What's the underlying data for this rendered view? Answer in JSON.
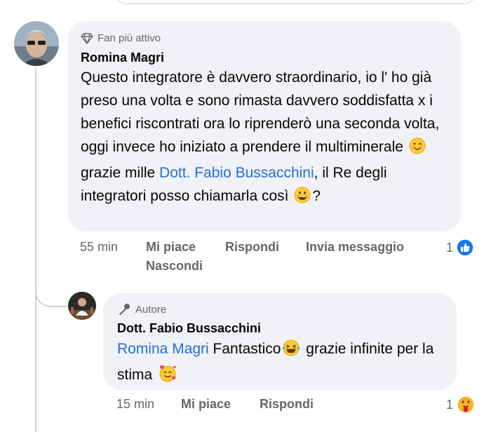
{
  "comment": {
    "badge": "Fan più attivo",
    "author": "Romina Magri",
    "text_part1": "Questo integratore è davvero straordinario, io l' ho già preso una volta e sono rimasta davvero soddisfatta x i benefici riscontrati ora lo riprenderò una seconda volta, oggi invece ho iniziato a prendere il multiminerale ",
    "text_part2": " grazie mille ",
    "mention": "Dott. Fabio Bussacchini",
    "text_part3": ", il Re degli integratori posso chiamarla così ",
    "text_part4": "?",
    "emoji1": "smiling-face-emoji",
    "emoji2": "grinning-face-emoji",
    "time": "55 min",
    "like": "Mi piace",
    "reply": "Rispondi",
    "message": "Invia messaggio",
    "hide": "Nascondi",
    "reaction_count": "1",
    "reaction_icon": "like-icon"
  },
  "reply": {
    "badge": "Autore",
    "author": "Dott. Fabio Bussacchini",
    "mention": "Romina Magri",
    "text_part1": " Fantastico",
    "text_part2": " grazie infinite per la stima ",
    "emoji1": "laughing-tears-emoji",
    "emoji2": "smiling-face-with-hearts-emoji",
    "time": "15 min",
    "like": "Mi piace",
    "reply": "Rispondi",
    "reaction_count": "1",
    "reaction_icon": "care-icon"
  },
  "colors": {
    "bubble": "#f0f2f5",
    "mention": "#216fdb",
    "meta": "#65676b",
    "like_blue": "#1877f2"
  }
}
